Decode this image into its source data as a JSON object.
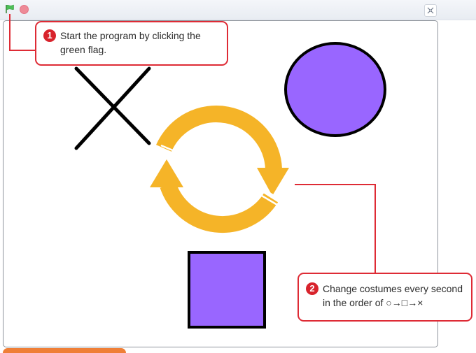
{
  "toolbar": {
    "green_flag_icon": "green-flag-icon",
    "stop_icon": "stop-sign-icon",
    "fullscreen_icon": "fullscreen-toggle-icon"
  },
  "stage": {
    "sprites": [
      "x-shape",
      "circle",
      "cycle-arrows",
      "square"
    ],
    "colors": {
      "sprite_fill": "#9966FF",
      "sprite_outline": "#000000",
      "cycle_arrows": "#F5B428"
    }
  },
  "callouts": [
    {
      "number": "1",
      "text": "Start the program by clicking the green flag."
    },
    {
      "number": "2",
      "text": "Change costumes every second in the order of ○→□→×"
    }
  ],
  "colors": {
    "callout_border": "#DE2B35",
    "callout_badge": "#D8232C",
    "flag": "#4CBF56",
    "stop": "#EC8996"
  }
}
